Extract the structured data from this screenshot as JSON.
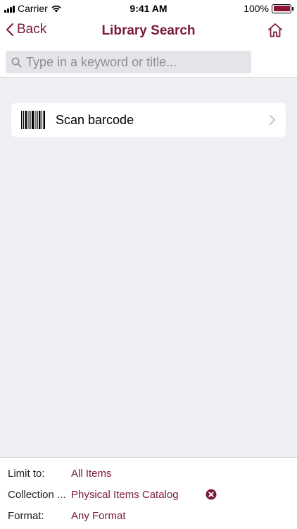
{
  "status_bar": {
    "carrier": "Carrier",
    "time": "9:41 AM",
    "battery": "100%",
    "battery_level": 1.0
  },
  "nav": {
    "back_label": "Back",
    "title": "Library Search",
    "home_icon": "home-icon"
  },
  "search": {
    "placeholder": "Type in a keyword or title...",
    "value": ""
  },
  "scan": {
    "label": "Scan barcode",
    "icon": "barcode-icon"
  },
  "filters": {
    "limit_label": "Limit to:",
    "limit_value": "All Items",
    "collection_label": "Collection ...",
    "collection_value": "Physical Items Catalog",
    "format_label": "Format:",
    "format_value": "Any Format"
  },
  "colors": {
    "accent": "#7b1a3a",
    "background": "#efeff4"
  }
}
